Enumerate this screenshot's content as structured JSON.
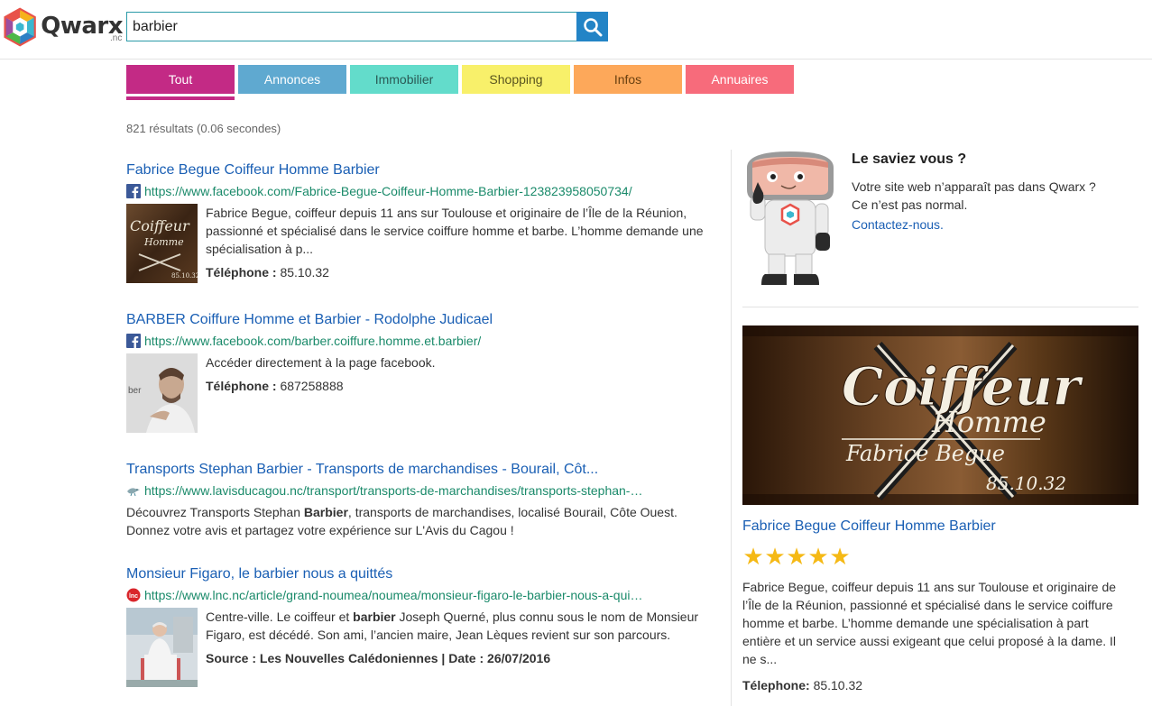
{
  "brand": {
    "name": "Qwarx",
    "suffix": ".nc"
  },
  "search": {
    "value": "barbier",
    "button_icon": "search-icon"
  },
  "tabs": [
    {
      "label": "Tout",
      "bg": "#c32a85",
      "fg": "#ffffff",
      "active": true
    },
    {
      "label": "Annonces",
      "bg": "#5fa9d0",
      "fg": "#ffffff"
    },
    {
      "label": "Immobilier",
      "bg": "#63dccb",
      "fg": "#2a5a55"
    },
    {
      "label": "Shopping",
      "bg": "#f8f06a",
      "fg": "#5a5520"
    },
    {
      "label": "Infos",
      "bg": "#fda85a",
      "fg": "#6a4010"
    },
    {
      "label": "Annuaires",
      "bg": "#f76b7b",
      "fg": "#ffffff"
    }
  ],
  "result_count": "821 résultats (0.06 secondes)",
  "results": [
    {
      "title": "Fabrice Begue Coiffeur Homme Barbier",
      "favicon": "facebook-icon",
      "url": "https://www.facebook.com/Fabrice-Begue-Coiffeur-Homme-Barbier-123823958050734/",
      "text": "Fabrice Begue, coiffeur depuis 11 ans sur Toulouse et originaire de l’Île de la Réunion, passionné et spécialisé dans le service coiffure homme et barbe. L’homme demande une spécialisation à p...",
      "phone_label": "Téléphone :",
      "phone": "85.10.32"
    },
    {
      "title": "BARBER Coiffure Homme et Barbier - Rodolphe Judicael",
      "favicon": "facebook-icon",
      "url": "https://www.facebook.com/barber.coiffure.homme.et.barbier/",
      "text": "Accéder directement à la page facebook.",
      "phone_label": "Téléphone :",
      "phone": "687258888"
    },
    {
      "title": "Transports Stephan Barbier - Transports de marchandises - Bourail, Côt...",
      "favicon": "cagou-icon",
      "url": "https://www.lavisducagou.nc/transport/transports-de-marchandises/transports-stephan-…",
      "text_before": "Découvrez Transports Stephan ",
      "text_bold": "Barbier",
      "text_after": ", transports de marchandises, localisé Bourail, Côte Ouest. Donnez votre avis et partagez votre expérience sur L'Avis du Cagou !"
    },
    {
      "title": "Monsieur Figaro, le barbier nous a quittés",
      "favicon": "lnc-icon",
      "url": "https://www.lnc.nc/article/grand-noumea/noumea/monsieur-figaro-le-barbier-nous-a-qui…",
      "text_before": "Centre-ville. Le coiffeur et ",
      "text_bold": "barbier",
      "text_after": " Joseph Querné, plus connu sous le nom de Monsieur Figaro, est décédé. Son ami, l’ancien maire, Jean Lèques revient sur son parcours.",
      "source_label": "Source :",
      "source": "Les Nouvelles Calédoniennes",
      "date_label": "Date :",
      "date": "26/07/2016"
    }
  ],
  "sidebar": {
    "saviez_title": "Le saviez vous ?",
    "saviez_line1": "Votre site web n’apparaît pas dans Qwarx ?",
    "saviez_line2": "Ce n’est pas normal.",
    "contact_link": "Contactez-nous.",
    "card_title": "Fabrice Begue Coiffeur Homme Barbier",
    "rating": 5,
    "stars": [
      "★",
      "★",
      "★",
      "★",
      "★"
    ],
    "card_desc": "Fabrice Begue, coiffeur depuis 11 ans sur Toulouse et originaire de l’Île de la Réunion, passionné et spécialisé dans le service coiffure homme et barbe. L’homme demande une spécialisation à part entière et un service aussi exigeant que celui proposé à la dame. Il ne s...",
    "phone_label": "Télephone:",
    "phone": "85.10.32",
    "logo_text": {
      "line1": "Coiffeur",
      "line2": "Homme",
      "line3": "Fabrice Begue",
      "line4": "85.10.32"
    }
  }
}
